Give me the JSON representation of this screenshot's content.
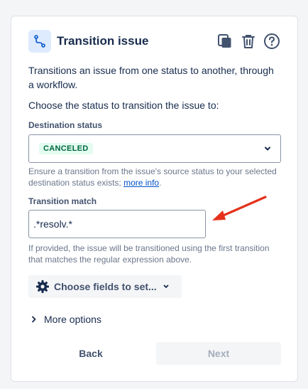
{
  "header": {
    "title": "Transition issue"
  },
  "description": {
    "intro": "Transitions an issue from one status to another, through a workflow.",
    "prompt": "Choose the status to transition the issue to:"
  },
  "destination": {
    "label": "Destination status",
    "selected_value": "CANCELED",
    "help_text": "Ensure a transition from the issue's source status to your selected destination status exists; ",
    "help_link": "more info",
    "help_end": "."
  },
  "transition_match": {
    "label": "Transition match",
    "value": ".*resolv.*",
    "help_text": "If provided, the issue will be transitioned using the first transition that matches the regular expression above."
  },
  "fields_button": {
    "label": "Choose fields to set..."
  },
  "more_options": {
    "label": "More options"
  },
  "footer": {
    "back_label": "Back",
    "next_label": "Next"
  },
  "colors": {
    "accent": "#0052cc",
    "lozenge_bg": "#e3fcef",
    "lozenge_text": "#006644",
    "annotation_arrow": "#e5311a"
  },
  "icons": {
    "header": "transition-icon",
    "copy": "copy-icon",
    "delete": "trash-icon",
    "help": "help-icon",
    "select": "chevron-down-icon",
    "fields": "gear-icon",
    "expand": "chevron-right-icon"
  }
}
